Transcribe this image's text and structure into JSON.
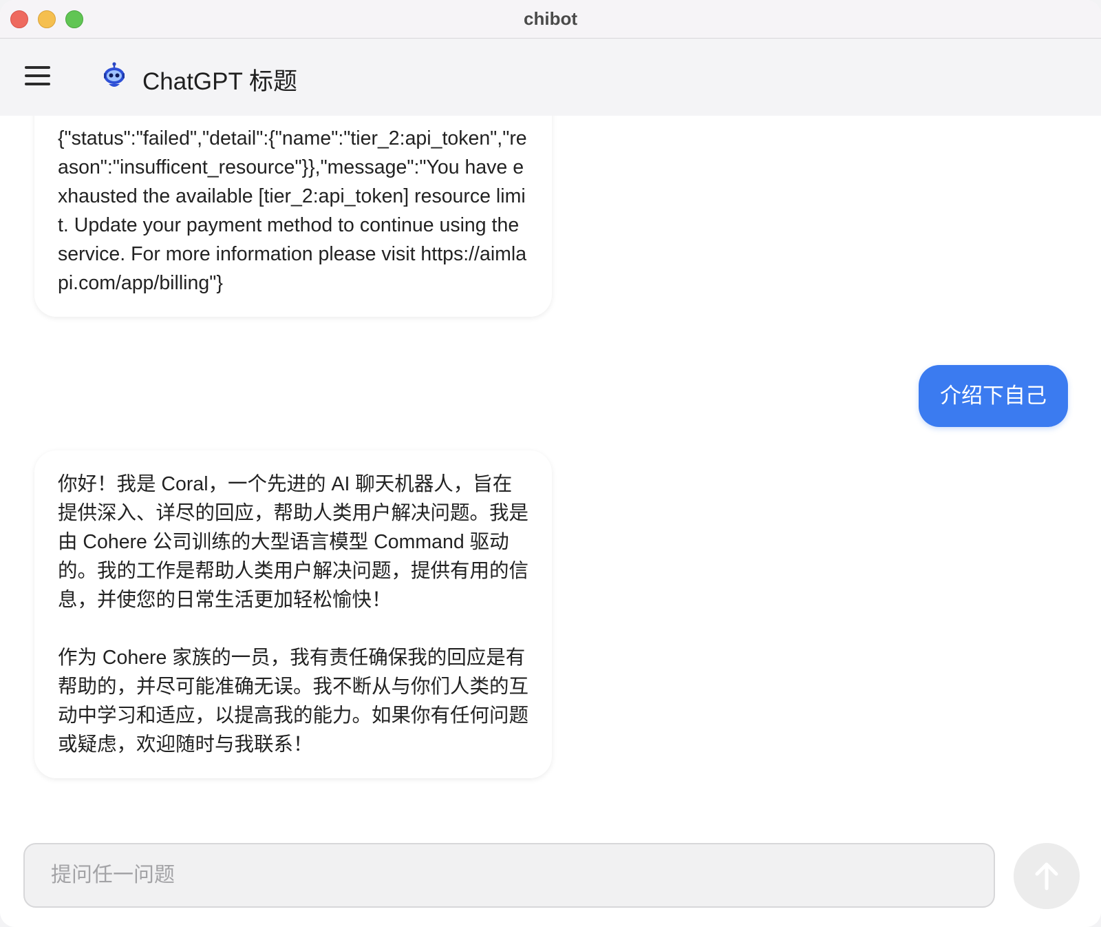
{
  "window": {
    "title": "chibot"
  },
  "header": {
    "menu_icon": "hamburger-menu-icon",
    "logo_icon": "robot-icon",
    "title": "ChatGPT 标题"
  },
  "messages": [
    {
      "role": "assistant",
      "text": "{\"status\":\"failed\",\"detail\":{\"name\":\"tier_2:api_token\",\"reason\":\"insufficent_resource\"}},\"message\":\"You have exhausted the available [tier_2:api_token] resource limit. Update your payment method to continue using the service. For more information please visit https://aimlapi.com/app/billing\"}"
    },
    {
      "role": "user",
      "text": "介绍下自己"
    },
    {
      "role": "assistant",
      "text": "你好！我是 Coral，一个先进的 AI 聊天机器人，旨在提供深入、详尽的回应，帮助人类用户解决问题。我是由 Cohere 公司训练的大型语言模型 Command 驱动的。我的工作是帮助人类用户解决问题，提供有用的信息，并使您的日常生活更加轻松愉快！\n\n作为 Cohere 家族的一员，我有责任确保我的回应是有帮助的，并尽可能准确无误。我不断从与你们人类的互动中学习和适应，以提高我的能力。如果你有任何问题或疑虑，欢迎随时与我联系！"
    }
  ],
  "composer": {
    "placeholder": "提问任一问题",
    "value": "",
    "send_icon": "arrow-up-icon"
  },
  "colors": {
    "accent": "#3b7bf0",
    "titlebar": "#f6f4f7",
    "appbar": "#f4f4f6"
  }
}
